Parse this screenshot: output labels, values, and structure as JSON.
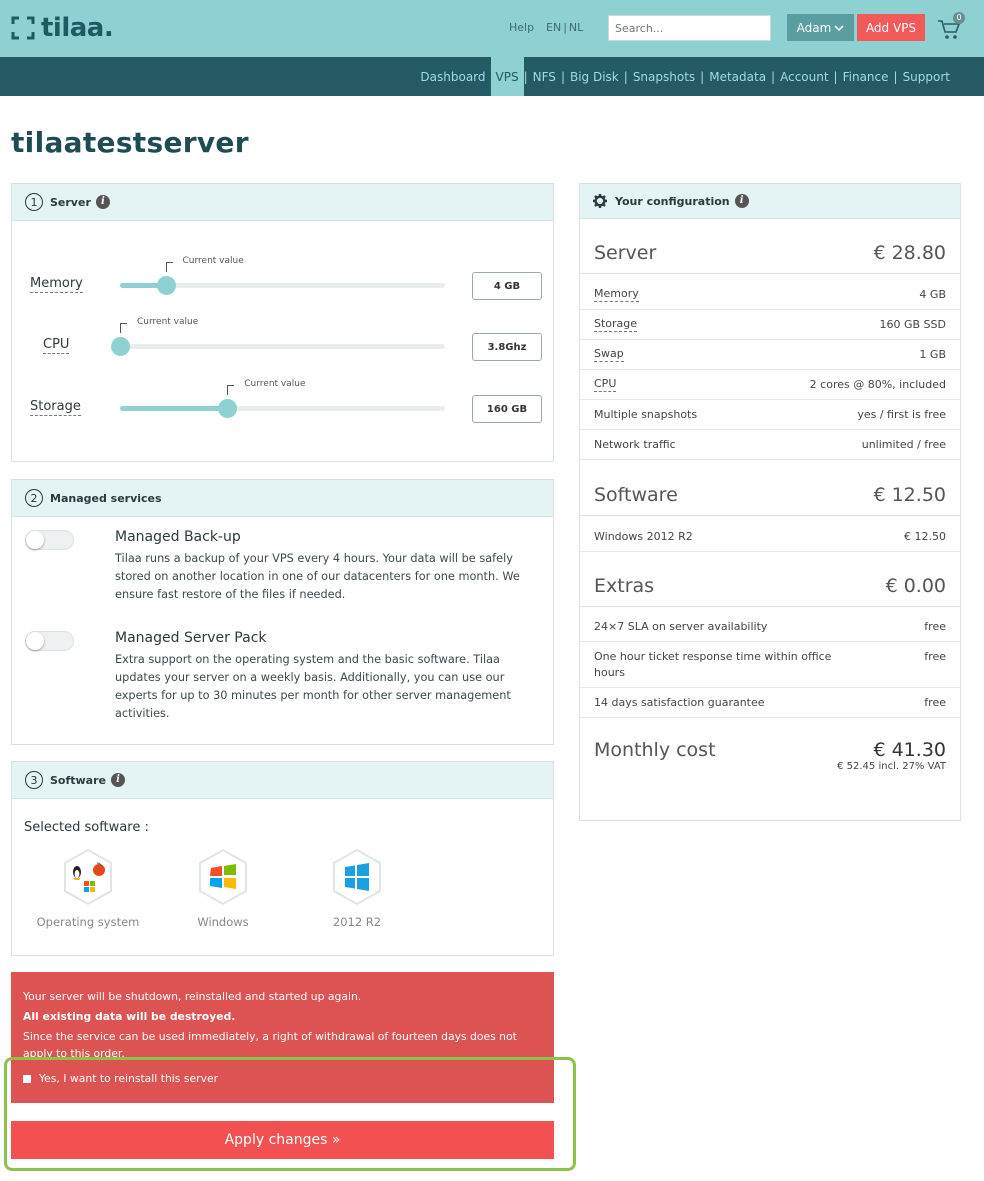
{
  "brand": {
    "name": "tilaa."
  },
  "topbar": {
    "help": "Help",
    "lang_en": "EN",
    "lang_sep": "|",
    "lang_nl": "NL",
    "search_placeholder": "Search...",
    "user": "Adam",
    "add_vps": "Add VPS",
    "cart_count": "0"
  },
  "nav": [
    "Dashboard",
    "VPS",
    "NFS",
    "Big Disk",
    "Snapshots",
    "Metadata",
    "Account",
    "Finance",
    "Support"
  ],
  "nav_active": "VPS",
  "page_title": "tilaatestserver",
  "server_panel": {
    "number": "1",
    "title": "Server",
    "current_label": "Current value",
    "sliders": [
      {
        "label": "Memory",
        "value": "4 GB",
        "fraction": 0.14
      },
      {
        "label": "CPU",
        "value": "3.8Ghz",
        "fraction": 0.0
      },
      {
        "label": "Storage",
        "value": "160 GB",
        "fraction": 0.33
      }
    ]
  },
  "managed_panel": {
    "number": "2",
    "title": "Managed services",
    "services": [
      {
        "title": "Managed Back-up",
        "desc": "Tilaa runs a backup of your VPS every 4 hours. Your data will be safely stored on another location in one of our datacenters for one month. We ensure fast restore of the files if needed.",
        "enabled": false
      },
      {
        "title": "Managed Server Pack",
        "desc": "Extra support on the operating system and the basic software. Tilaa updates your server on a weekly basis. Additionally, you can use our experts for up to 30 minutes per month for other server management activities.",
        "enabled": false
      }
    ]
  },
  "software_panel": {
    "number": "3",
    "title": "Software",
    "selected_label": "Selected software :",
    "items": [
      {
        "caption": "Operating system",
        "icon": "os-mixed-icon"
      },
      {
        "caption": "Windows",
        "icon": "windows-flag-icon"
      },
      {
        "caption": "2012 R2",
        "icon": "windows-tile-icon"
      }
    ]
  },
  "alert": {
    "line1": "Your server will be shutdown, reinstalled and started up again.",
    "line2": "All existing data will be destroyed.",
    "line3": "Since the service can be used immediately, a right of withdrawal of fourteen days does not apply to this order.",
    "checkbox_label": "Yes, I want to reinstall this server"
  },
  "apply_button": "Apply changes »",
  "config": {
    "title": "Your configuration",
    "server": {
      "label": "Server",
      "price": "€ 28.80"
    },
    "server_rows": [
      {
        "k": "Memory",
        "v": "4 GB"
      },
      {
        "k": "Storage",
        "v": "160 GB SSD"
      },
      {
        "k": "Swap",
        "v": "1 GB"
      },
      {
        "k": "CPU",
        "v": "2 cores @ 80%, included"
      },
      {
        "k": "Multiple snapshots",
        "v": "yes / first is free"
      },
      {
        "k": "Network traffic",
        "v": "unlimited / free"
      }
    ],
    "software": {
      "label": "Software",
      "price": "€ 12.50"
    },
    "software_rows": [
      {
        "k": "Windows 2012 R2",
        "v": "€ 12.50"
      }
    ],
    "extras": {
      "label": "Extras",
      "price": "€ 0.00"
    },
    "extras_rows": [
      {
        "k": "24×7 SLA on server availability",
        "v": "free"
      },
      {
        "k": "One hour ticket response time within office hours",
        "v": "free"
      },
      {
        "k": "14 days satisfaction guarantee",
        "v": "free"
      }
    ],
    "monthly": {
      "label": "Monthly cost",
      "price": "€ 41.30",
      "vat": "€ 52.45 incl. 27% VAT"
    }
  },
  "colors": {
    "brand": "#8fd0d3",
    "nav": "#235a63",
    "danger": "#f25051",
    "alert": "#dc5352"
  }
}
